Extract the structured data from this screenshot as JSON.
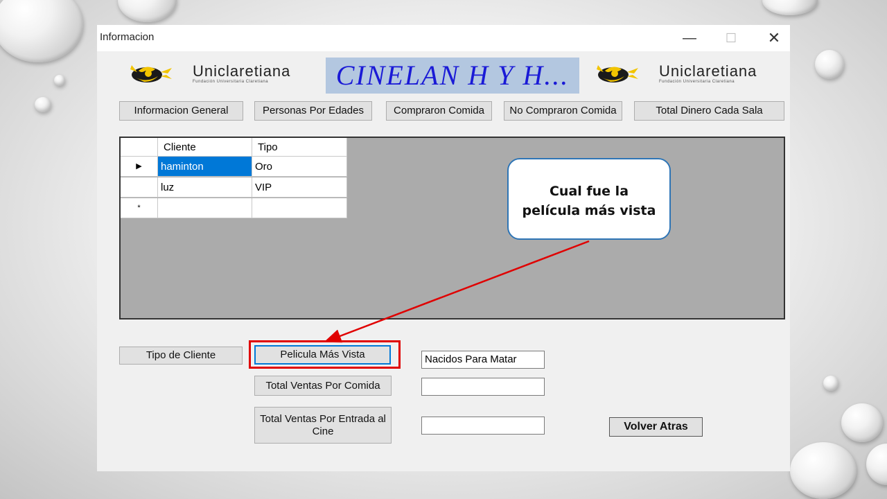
{
  "window": {
    "title": "Informacion",
    "minimize_icon": "minimize-icon",
    "maximize_icon": "maximize-icon",
    "close_icon": "close-icon"
  },
  "header": {
    "logo_text": "Uniclaretiana",
    "logo_subtext": "Fundación Universitaria Claretiana",
    "banner": "CINELAN H Y H..."
  },
  "nav_buttons": [
    {
      "label": "Informacion General"
    },
    {
      "label": "Personas Por Edades"
    },
    {
      "label": "Compraron Comida"
    },
    {
      "label": "No Compraron Comida"
    },
    {
      "label": "Total Dinero Cada Sala"
    }
  ],
  "grid": {
    "columns": [
      "Cliente",
      "Tipo"
    ],
    "rows": [
      {
        "indicator": "▶",
        "cells": [
          "haminton",
          "Oro"
        ]
      },
      {
        "indicator": "",
        "cells": [
          "luz",
          "VIP"
        ]
      },
      {
        "indicator": "*",
        "cells": [
          "",
          ""
        ]
      }
    ]
  },
  "actions": {
    "tipo_cliente": "Tipo de Cliente",
    "pelicula_mas_vista": "Pelicula Más Vista",
    "total_ventas_comida": "Total Ventas Por Comida",
    "total_ventas_entrada": "Total Ventas Por Entrada al Cine",
    "volver_atras": "Volver Atras"
  },
  "outputs": {
    "pelicula_mas_vista_value": "Nacidos Para Matar",
    "total_ventas_comida_value": "",
    "total_ventas_entrada_value": ""
  },
  "annotation": {
    "callout_text": "Cual fue la película más vista",
    "highlight_color": "#e00000",
    "callout_border_color": "#2e75b6"
  }
}
